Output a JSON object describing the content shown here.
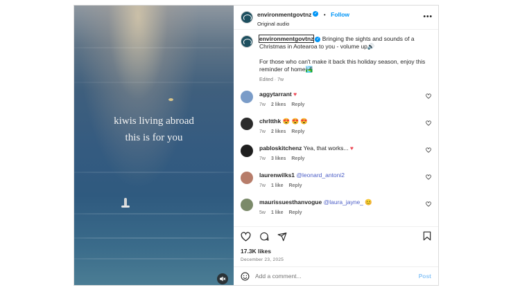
{
  "media": {
    "overlay_line1": "kiwis living abroad",
    "overlay_line2": "this is for you",
    "mute_icon": "speaker-muted-icon"
  },
  "header": {
    "username": "environmentgovtnz",
    "separator": "•",
    "follow_label": "Follow",
    "audio_label": "Original audio",
    "more_icon": "•••"
  },
  "caption": {
    "username": "environmentgovtnz",
    "text1": "Bringing the sights and sounds of a Christmas in Aotearoa to you - volume up🔊",
    "text2": "For those who can't make it back this holiday season, enjoy this reminder of home🏞️",
    "edited": "Edited · 7w"
  },
  "comments": [
    {
      "username": "aggytarrant",
      "text": "",
      "emoji": "♥",
      "age": "7w",
      "likes": "2 likes",
      "reply": "Reply",
      "color": "#7a9cc8"
    },
    {
      "username": "chrltthk",
      "text": "",
      "emoji": "😍 😍 😍",
      "age": "7w",
      "likes": "2 likes",
      "reply": "Reply",
      "color": "#2b2b2b"
    },
    {
      "username": "pabloskitchenz",
      "text": "Yea, that works...",
      "emoji": "♥",
      "age": "7w",
      "likes": "3 likes",
      "reply": "Reply",
      "color": "#1f1f1f"
    },
    {
      "username": "laurenwilks1",
      "text": "@leonard_antoni2",
      "emoji": "",
      "age": "7w",
      "likes": "1 like",
      "reply": "Reply",
      "color": "#b77d6a"
    },
    {
      "username": "maurissuesthanvogue",
      "text": "@laura_jayne_",
      "emoji": "😊",
      "age": "5w",
      "likes": "1 like",
      "reply": "Reply",
      "color": "#7b8a6a"
    }
  ],
  "actions": {
    "like_icon": "heart-icon",
    "comment_icon": "comment-icon",
    "share_icon": "share-icon",
    "save_icon": "bookmark-icon"
  },
  "likes": "17.3K likes",
  "date": "December 23, 2025",
  "add_comment": {
    "placeholder": "Add a comment...",
    "post_label": "Post"
  },
  "colors": {
    "accent": "#0095f6",
    "heart": "#ed4956",
    "mention": "#4b5dc6"
  }
}
